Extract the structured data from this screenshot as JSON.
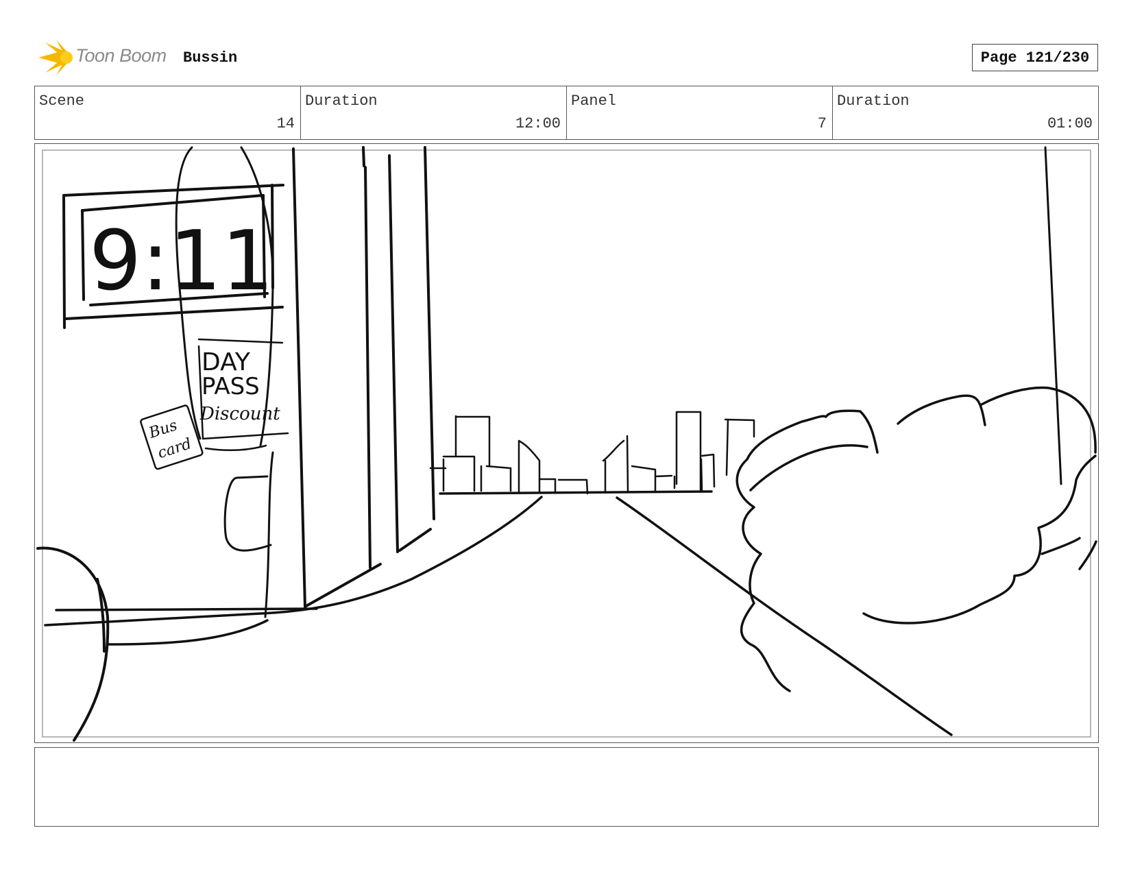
{
  "header": {
    "logo_text": "Toon Boom",
    "project_title": "Bussin",
    "page_label": "Page 121/230"
  },
  "info": {
    "scene_label": "Scene",
    "scene_value": "14",
    "scene_duration_label": "Duration",
    "scene_duration_value": "12:00",
    "panel_label": "Panel",
    "panel_value": "7",
    "panel_duration_label": "Duration",
    "panel_duration_value": "01:00"
  },
  "sketch": {
    "clock_text": "9:11",
    "sign_line_1": "DAY",
    "sign_line_2": "PASS",
    "sign_line_3": "Discount",
    "card_line_1": "Bus",
    "card_line_2": "card"
  },
  "colors": {
    "logo_accent": "#f5b800",
    "ink": "#111111"
  }
}
